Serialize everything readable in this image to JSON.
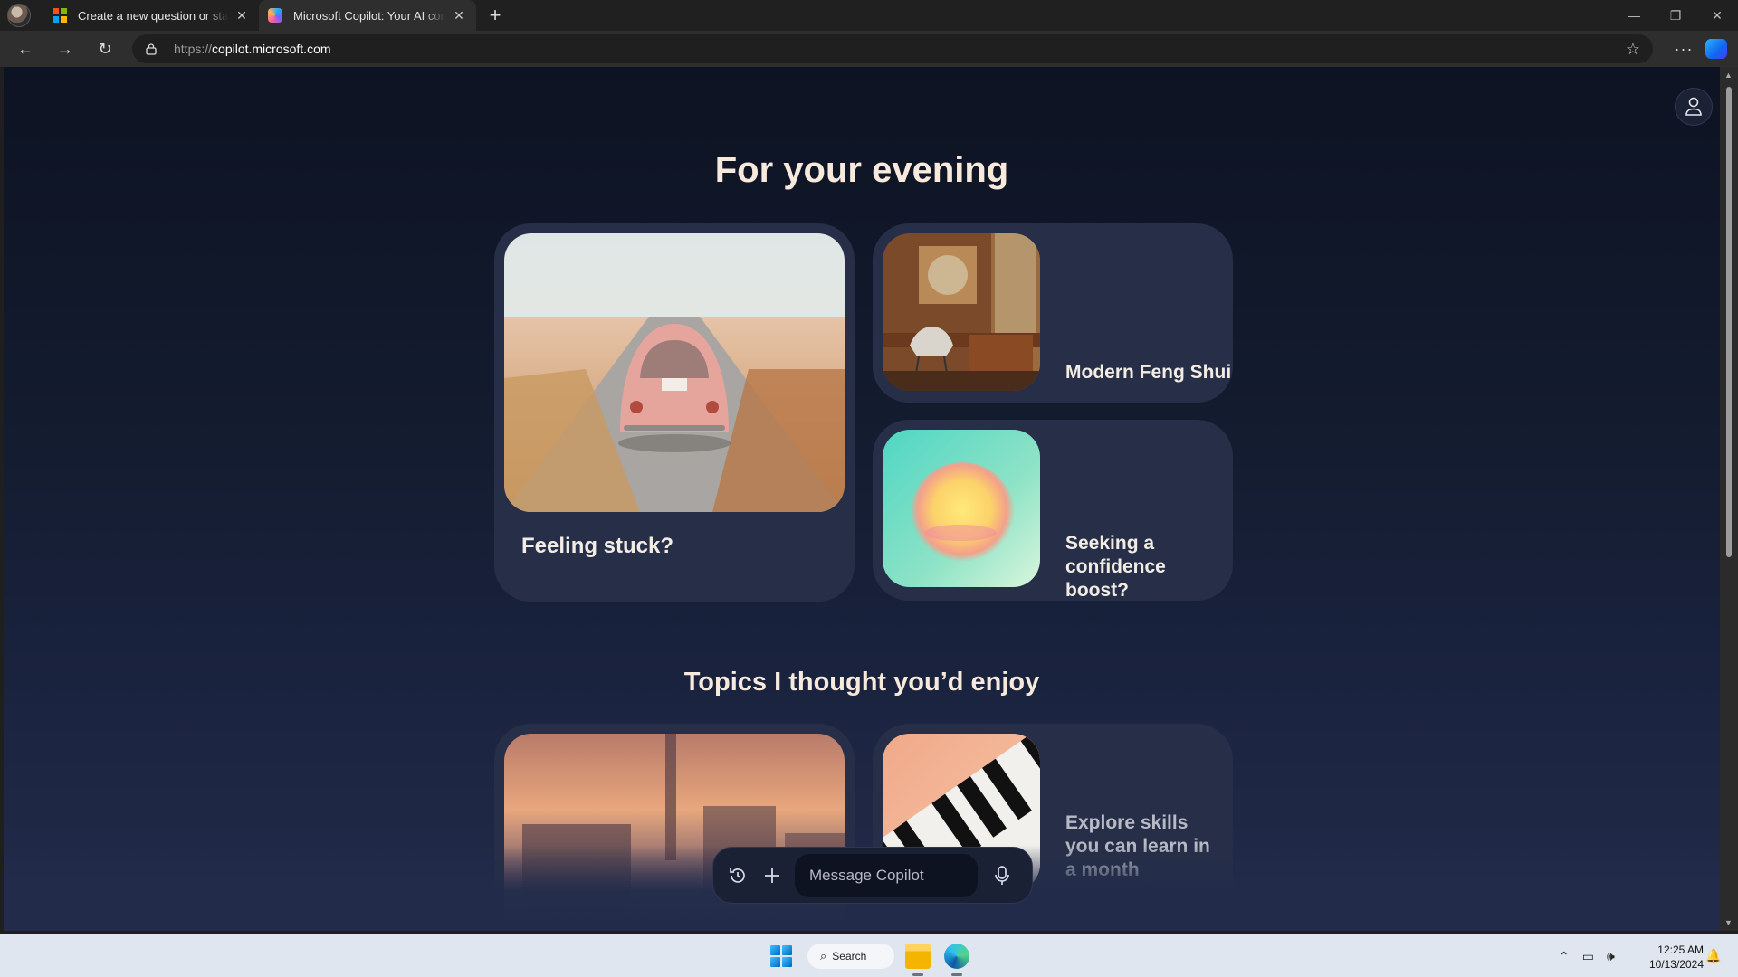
{
  "browser": {
    "tabs": [
      {
        "title": "Create a new question or start a discussion",
        "favicon": "microsoft-logo"
      },
      {
        "title": "Microsoft Copilot: Your AI companion",
        "favicon": "copilot-logo"
      }
    ],
    "url_protocol": "https://",
    "url_host": "copilot.microsoft.com"
  },
  "page": {
    "evening_heading": "For your evening",
    "cards": {
      "stuck": "Feeling stuck?",
      "feng_shui": "Modern Feng Shui",
      "confidence": "Seeking a confidence boost?",
      "skills": "Explore skills you can learn in a month"
    },
    "topics_heading": "Topics I thought you’d enjoy",
    "composer": {
      "placeholder": "Message Copilot"
    }
  },
  "taskbar": {
    "search_label": "Search",
    "time": "12:25 AM",
    "date": "10/13/2024"
  },
  "colors": {
    "accent": "#1ea7ff",
    "page_bg_top": "#0d1322",
    "page_bg_bottom": "#222c4a",
    "card_bg": "#272f48",
    "heading": "#f7e9dc"
  }
}
